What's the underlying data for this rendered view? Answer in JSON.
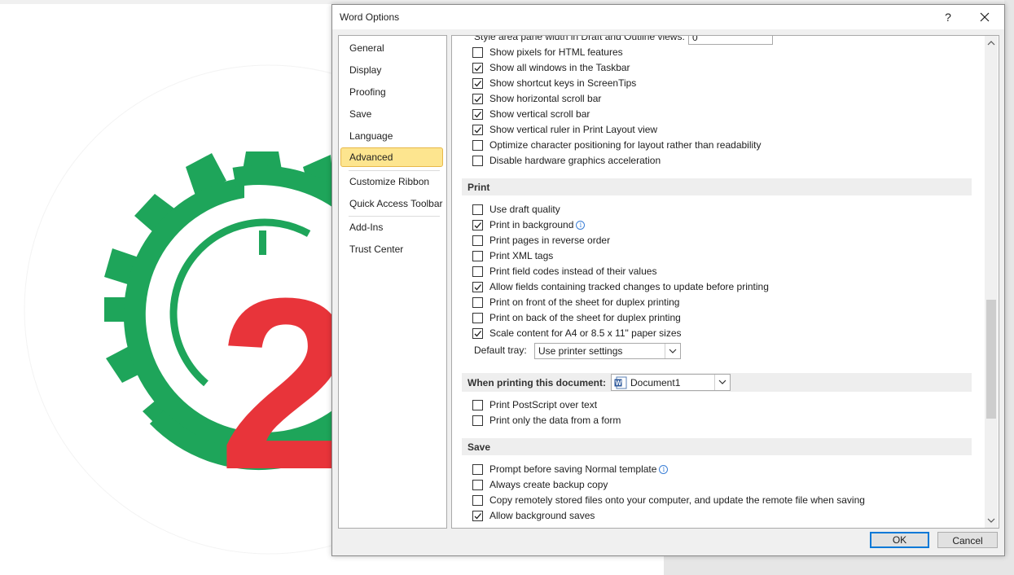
{
  "dialog": {
    "title": "Word Options",
    "help_label": "?"
  },
  "nav": {
    "items": [
      "General",
      "Display",
      "Proofing",
      "Save",
      "Language",
      "Advanced",
      "Customize Ribbon",
      "Quick Access Toolbar",
      "Add-Ins",
      "Trust Center"
    ],
    "selected": "Advanced"
  },
  "display_options": {
    "partial_row": "Style area pane width in Draft and Outline views:",
    "partial_value": "0",
    "items": [
      {
        "label": "Show pixels for HTML features",
        "checked": false
      },
      {
        "label": "Show all windows in the Taskbar",
        "checked": true
      },
      {
        "label": "Show shortcut keys in ScreenTips",
        "checked": true
      },
      {
        "label": "Show horizontal scroll bar",
        "checked": true
      },
      {
        "label": "Show vertical scroll bar",
        "checked": true
      },
      {
        "label": "Show vertical ruler in Print Layout view",
        "checked": true
      },
      {
        "label": "Optimize character positioning for layout rather than readability",
        "checked": false
      },
      {
        "label": "Disable hardware graphics acceleration",
        "checked": false
      }
    ]
  },
  "print": {
    "heading": "Print",
    "items": [
      {
        "label": "Use draft quality",
        "checked": false
      },
      {
        "label": "Print in background",
        "checked": true
      },
      {
        "label": "Print pages in reverse order",
        "checked": false
      },
      {
        "label": "Print XML tags",
        "checked": false
      },
      {
        "label": "Print field codes instead of their values",
        "checked": false
      },
      {
        "label": "Allow fields containing tracked changes to update before printing",
        "checked": true
      },
      {
        "label": "Print on front of the sheet for duplex printing",
        "checked": false
      },
      {
        "label": "Print on back of the sheet for duplex printing",
        "checked": false
      },
      {
        "label": "Scale content for A4 or 8.5 x 11\" paper sizes",
        "checked": true
      }
    ],
    "tray_label": "Default tray:",
    "tray_value": "Use printer settings"
  },
  "when_printing": {
    "heading": "When printing this document:",
    "document": "Document1",
    "items": [
      {
        "label": "Print PostScript over text",
        "checked": false
      },
      {
        "label": "Print only the data from a form",
        "checked": false
      }
    ]
  },
  "save": {
    "heading": "Save",
    "items": [
      {
        "label": "Prompt before saving Normal template",
        "checked": false
      },
      {
        "label": "Always create backup copy",
        "checked": false
      },
      {
        "label": "Copy remotely stored files onto your computer, and update the remote file when saving",
        "checked": false
      },
      {
        "label": "Allow background saves",
        "checked": true
      }
    ]
  },
  "buttons": {
    "ok": "OK",
    "cancel": "Cancel"
  },
  "colors": {
    "selected_nav_bg": "#fde58f",
    "logo_green": "#1ea55a",
    "logo_red": "#e8343a",
    "ok_border": "#0078d7",
    "info_blue": "#3b7fd6"
  },
  "background_logo": {
    "glyph": "2"
  }
}
